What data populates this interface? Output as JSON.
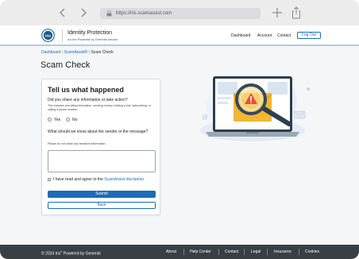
{
  "browser": {
    "url": "https://iris.scamassist.com",
    "icons": [
      "back-icon",
      "forward-icon",
      "lock-icon",
      "new-tab-icon",
      "share-icon"
    ]
  },
  "header": {
    "brand_title": "Identity Protection",
    "brand_subtitle": "An Iris Powered by Generali service",
    "logo_text": "iris",
    "nav": [
      "Dashboard",
      "Account",
      "Contact"
    ],
    "logout_label": "Log Out"
  },
  "breadcrumb": {
    "items": [
      "Dashboard",
      "ScamAssist®",
      "Scam Check"
    ],
    "separator": "|"
  },
  "page_title": "Scam Check",
  "form": {
    "title": "Tell us what happened",
    "question1": "Did you share any information or take action?",
    "question1_help": "This includes providing information, sending money, clicking a link, subscribing, or calling a phone number.",
    "option_yes": "Yes",
    "option_no": "No",
    "question2": "What should we know about the sender or the message?",
    "question2_help": "Please do not share any sensitive information.",
    "message_value": "",
    "agree_text": "I have read and agree to the",
    "agree_link": "ScamAssist disclaimer.",
    "submit_label": "Submit",
    "back_label": "Back"
  },
  "footer": {
    "copyright_prefix": "© 2024 Iris",
    "copyright_reg": "®",
    "copyright_suffix": " Powered by Generali",
    "links": [
      "About",
      "Help Center",
      "Contact",
      "Legal",
      "Insurance",
      "Cookies"
    ]
  },
  "colors": {
    "accent": "#1f6bb5",
    "footer_bg": "#3a3f44",
    "warning": "#e84c3d",
    "envelope": "#f2b632"
  }
}
